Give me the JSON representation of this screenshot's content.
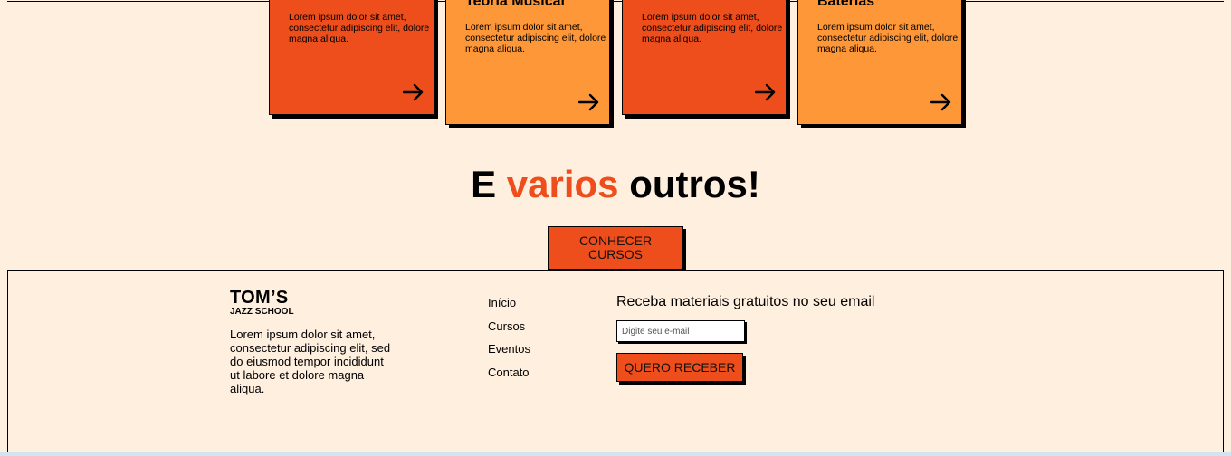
{
  "colors": {
    "background": "#FFEFDF",
    "accent_red": "#EE4D1C",
    "accent_orange": "#FE9738",
    "text": "#000000"
  },
  "cards": [
    {
      "title": "",
      "description": "Lorem ipsum dolor sit amet, consectetur adipiscing elit, dolore magna aliqua.",
      "icon": "arrow-right-icon",
      "color": "#EE4D1C"
    },
    {
      "title": "Teoria Musical",
      "description": "Lorem ipsum dolor sit amet, consectetur adipiscing elit, dolore magna aliqua.",
      "icon": "arrow-right-icon",
      "color": "#FE9738"
    },
    {
      "title": "",
      "description": "Lorem ipsum dolor sit amet, consectetur adipiscing elit, dolore magna aliqua.",
      "icon": "arrow-right-icon",
      "color": "#EE4D1C"
    },
    {
      "title": "Baterias",
      "description": "Lorem ipsum dolor sit amet, consectetur adipiscing elit, dolore magna aliqua.",
      "icon": "arrow-right-icon",
      "color": "#FE9738"
    }
  ],
  "headline": {
    "prefix": "E",
    "accent": "varios",
    "suffix": "outros!"
  },
  "cta": {
    "label": "CONHECER CURSOS"
  },
  "footer": {
    "brand": {
      "name": "TOM’S",
      "tagline": "JAZZ SCHOOL"
    },
    "description": "Lorem ipsum dolor sit amet, consectetur adipiscing elit, sed do eiusmod tempor incididunt ut labore et dolore magna aliqua.",
    "nav": [
      "Início",
      "Cursos",
      "Eventos",
      "Contato"
    ],
    "newsletter": {
      "title": "Receba materiais gratuitos no seu email",
      "placeholder": "Digite seu e-mail",
      "button_label": "QUERO RECEBER"
    }
  }
}
